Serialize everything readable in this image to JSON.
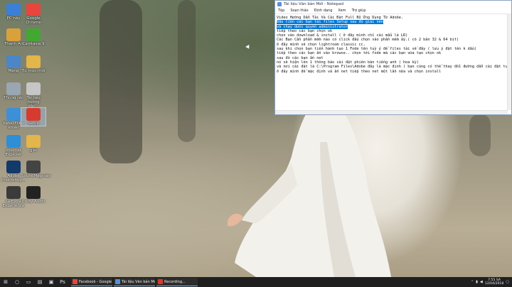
{
  "desktop_icons": [
    {
      "label": "PC này",
      "icon": "computer-icon",
      "color": "#3c7fd6"
    },
    {
      "label": "Google Chrome",
      "icon": "chrome-icon",
      "color": "#e8453c"
    },
    {
      "label": "Thanh An",
      "icon": "folder-user-icon",
      "color": "#d9a13b"
    },
    {
      "label": "Camtasia 9",
      "icon": "camtasia-icon",
      "color": "#42a832"
    },
    {
      "label": "Mạng",
      "icon": "network-icon",
      "color": "#4a86c8"
    },
    {
      "label": "Tư mục mới",
      "icon": "folder-icon",
      "color": "#e2b64a"
    },
    {
      "label": "Thùng rác",
      "icon": "recycle-bin-icon",
      "color": "#9aa6b2"
    },
    {
      "label": "Tài liệu hướng dẫn...",
      "icon": "document-icon",
      "color": "#c6c6c6"
    },
    {
      "label": "Panel Điều khiển",
      "icon": "control-panel-icon",
      "color": "#3d8fd8"
    },
    {
      "label": "Setup",
      "icon": "setup-icon",
      "color": "#d63b2f"
    },
    {
      "label": "Internet Explorer",
      "icon": "ie-icon",
      "color": "#2e8ed6"
    },
    {
      "label": "giải",
      "icon": "folder-icon",
      "color": "#e2b64a"
    },
    {
      "label": "Adobe Photoshop...",
      "icon": "photoshop-icon",
      "color": "#123a6b"
    },
    {
      "label": "SoundMagician",
      "icon": "sound-icon",
      "color": "#444444"
    },
    {
      "label": "GeForce Experience",
      "icon": "geforce-icon",
      "color": "#3b3b3b"
    },
    {
      "label": "Dolby Audio",
      "icon": "dolby-icon",
      "color": "#222222"
    }
  ],
  "notepad": {
    "title": "Tài liệu Văn bản Mới - Notepad",
    "menu": [
      "Tệp",
      "Soạn thảo",
      "Định dạng",
      "Xem",
      "Trợ giúp"
    ],
    "lines": [
      "Video Hướng Dẫn Tải Và Cài Đặt Full Bộ Ứng Dụng Từ Adobe.",
      "Đầu tiên các bạn tải files Setup sau đó giải nén",
      "và chạy dưới quyền administrator",
      "tiếp theo các bạn chọn ok",
      "chọn vào download & install ( ở đây mình chỉ cài mẫu là LR)",
      "Các Bạn Cần phần mềm nào có click đấu chọn vào phần mềm ấy.( có 2 bản 32 & 64 bit)",
      "ở đây mình sẽ chọn lightroom classic cc.",
      "sau khi chọn bạn tiến hành tạo 1 Fode tên tuỳ ý để files tải về đây ( lưu ý đặt tên k dấu)",
      "tiếp theo các bạn ấn vào browse.. chọn tới fode mà các bạn vừa tạo chọn ok",
      "sau đó các bạn ấn net",
      "nó sẽ hiện lên 1 thông báo cài đặt phiên bản tiếng anh ( hoa kỳ)",
      "và nơi cài đặt là C:\\Program Files\\Adobe đây là mặc định ( bạn cũng có thể thay đổi đường dẫn cài đặt tuỳ ý)",
      "ở đây mình để mặc định và ấn net tiếp theo net một lần nữa và chọn install"
    ],
    "highlighted_lines": [
      1,
      2
    ]
  },
  "taskbar": {
    "pinned": [
      {
        "name": "start-button",
        "glyph": "⊞"
      },
      {
        "name": "search-icon",
        "glyph": "○"
      },
      {
        "name": "task-view-icon",
        "glyph": "▭"
      },
      {
        "name": "file-explorer-icon",
        "glyph": "▤"
      },
      {
        "name": "store-icon",
        "glyph": "▣"
      },
      {
        "name": "photoshop-taskbar-icon",
        "glyph": "Ps"
      }
    ],
    "tasks": [
      {
        "label": "Facebook - Google ...",
        "color": "#e8453c"
      },
      {
        "label": "Tài liệu Văn bản Mớ...",
        "color": "#5b8fd1"
      },
      {
        "label": "Recording...",
        "color": "#d63b2f"
      }
    ],
    "time": "7:55 SA",
    "date": "12/04/2018"
  }
}
